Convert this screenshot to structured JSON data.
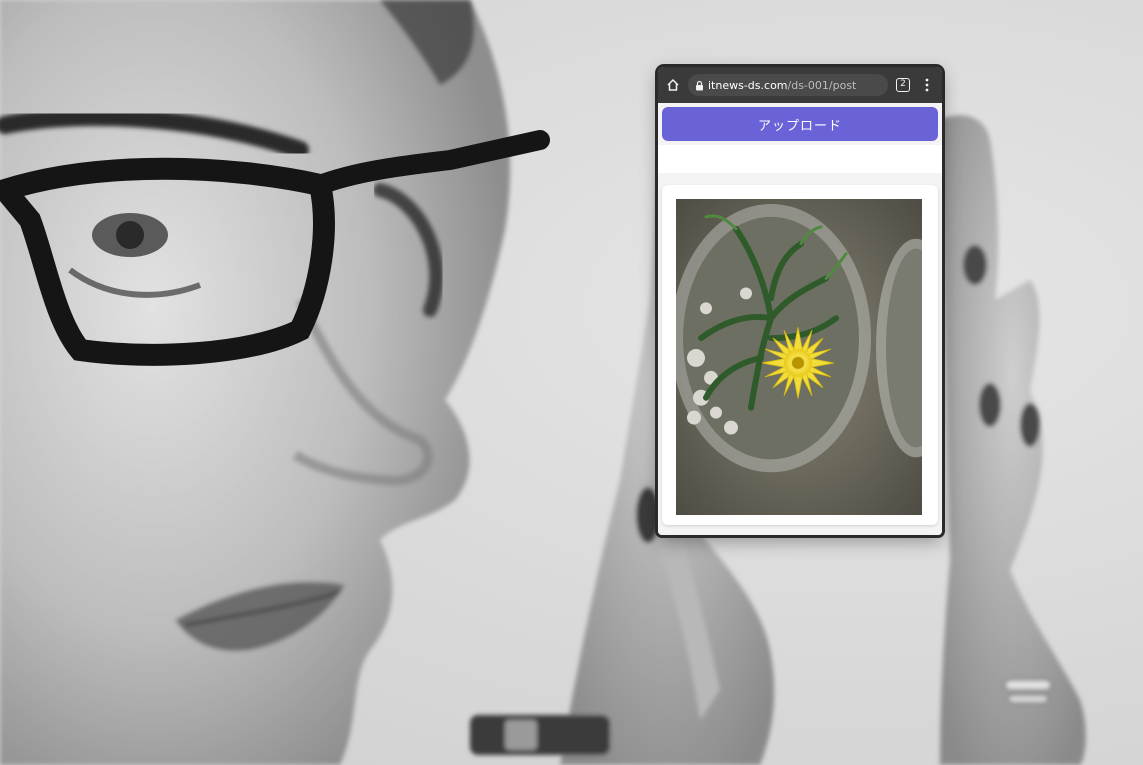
{
  "browser": {
    "home_icon": "home-icon",
    "lock_icon": "lock-icon",
    "url_host": "itnews-ds.com",
    "url_path": "/ds-001/post",
    "tab_count": "2",
    "menu_icon": "kebab-menu-icon"
  },
  "page": {
    "upload_label": "アップロード",
    "accent_color": "#6a63d8",
    "preview_image": "yellow-flower-in-glass-jar-photo"
  }
}
